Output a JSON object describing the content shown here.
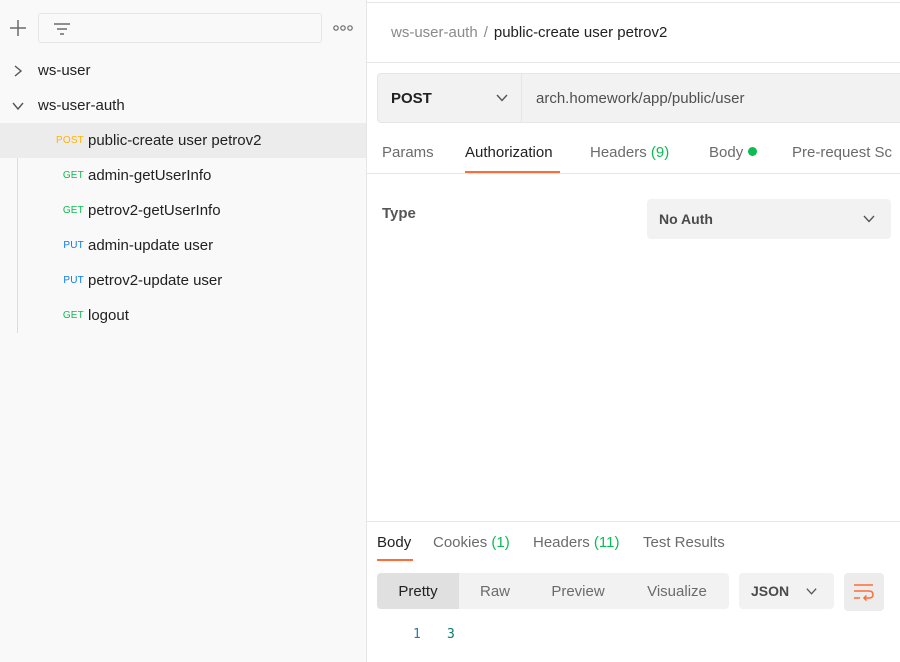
{
  "sidebar": {
    "filter_placeholder": "",
    "collections": [
      {
        "label": "ws-user",
        "expanded": false
      },
      {
        "label": "ws-user-auth",
        "expanded": true
      }
    ],
    "requests": [
      {
        "method": "POST",
        "label": "public-create user petrov2",
        "active": true
      },
      {
        "method": "GET",
        "label": "admin-getUserInfo"
      },
      {
        "method": "GET",
        "label": "petrov2-getUserInfo"
      },
      {
        "method": "PUT",
        "label": "admin-update user"
      },
      {
        "method": "PUT",
        "label": "petrov2-update user"
      },
      {
        "method": "GET",
        "label": "logout"
      }
    ]
  },
  "breadcrumb": {
    "parent": "ws-user-auth",
    "separator": "/",
    "current": "public-create user petrov2"
  },
  "request": {
    "method": "POST",
    "url": "arch.homework/app/public/user"
  },
  "request_tabs": {
    "params": "Params",
    "authorization": "Authorization",
    "headers": "Headers",
    "headers_count": "(9)",
    "body": "Body",
    "prerequest": "Pre-request Sc"
  },
  "auth": {
    "type_label": "Type",
    "type_value": "No Auth"
  },
  "response_tabs": {
    "body": "Body",
    "cookies": "Cookies",
    "cookies_count": "(1)",
    "headers": "Headers",
    "headers_count": "(11)",
    "test_results": "Test Results"
  },
  "response_view": {
    "modes": [
      "Pretty",
      "Raw",
      "Preview",
      "Visualize"
    ],
    "active_mode": "Pretty",
    "format": "JSON"
  },
  "response_body": {
    "line_number": "1",
    "content": "3"
  },
  "colors": {
    "accent": "#ff6c37",
    "get": "#0cbb52",
    "post": "#ffb400",
    "put": "#097bed"
  }
}
